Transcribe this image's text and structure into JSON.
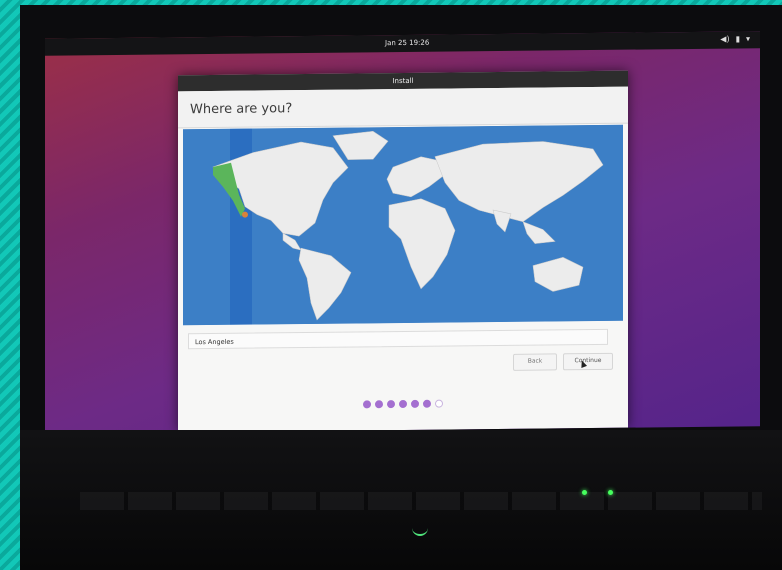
{
  "topbar": {
    "clock": "Jan 25  19:26",
    "tray_icons": [
      "volume-icon",
      "battery-icon",
      "chevron-down-icon"
    ]
  },
  "window": {
    "title": "Install",
    "heading": "Where are you?"
  },
  "location": {
    "city_value": "Los Angeles"
  },
  "buttons": {
    "back": "Back",
    "continue": "Continue"
  },
  "progress": {
    "total_steps": 7,
    "completed_steps": 6
  },
  "colors": {
    "accent": "#a46fd0",
    "map_ocean": "#3c7fc6",
    "timezone_highlight": "#2b6ec0",
    "selected_region": "#5bb55b"
  }
}
